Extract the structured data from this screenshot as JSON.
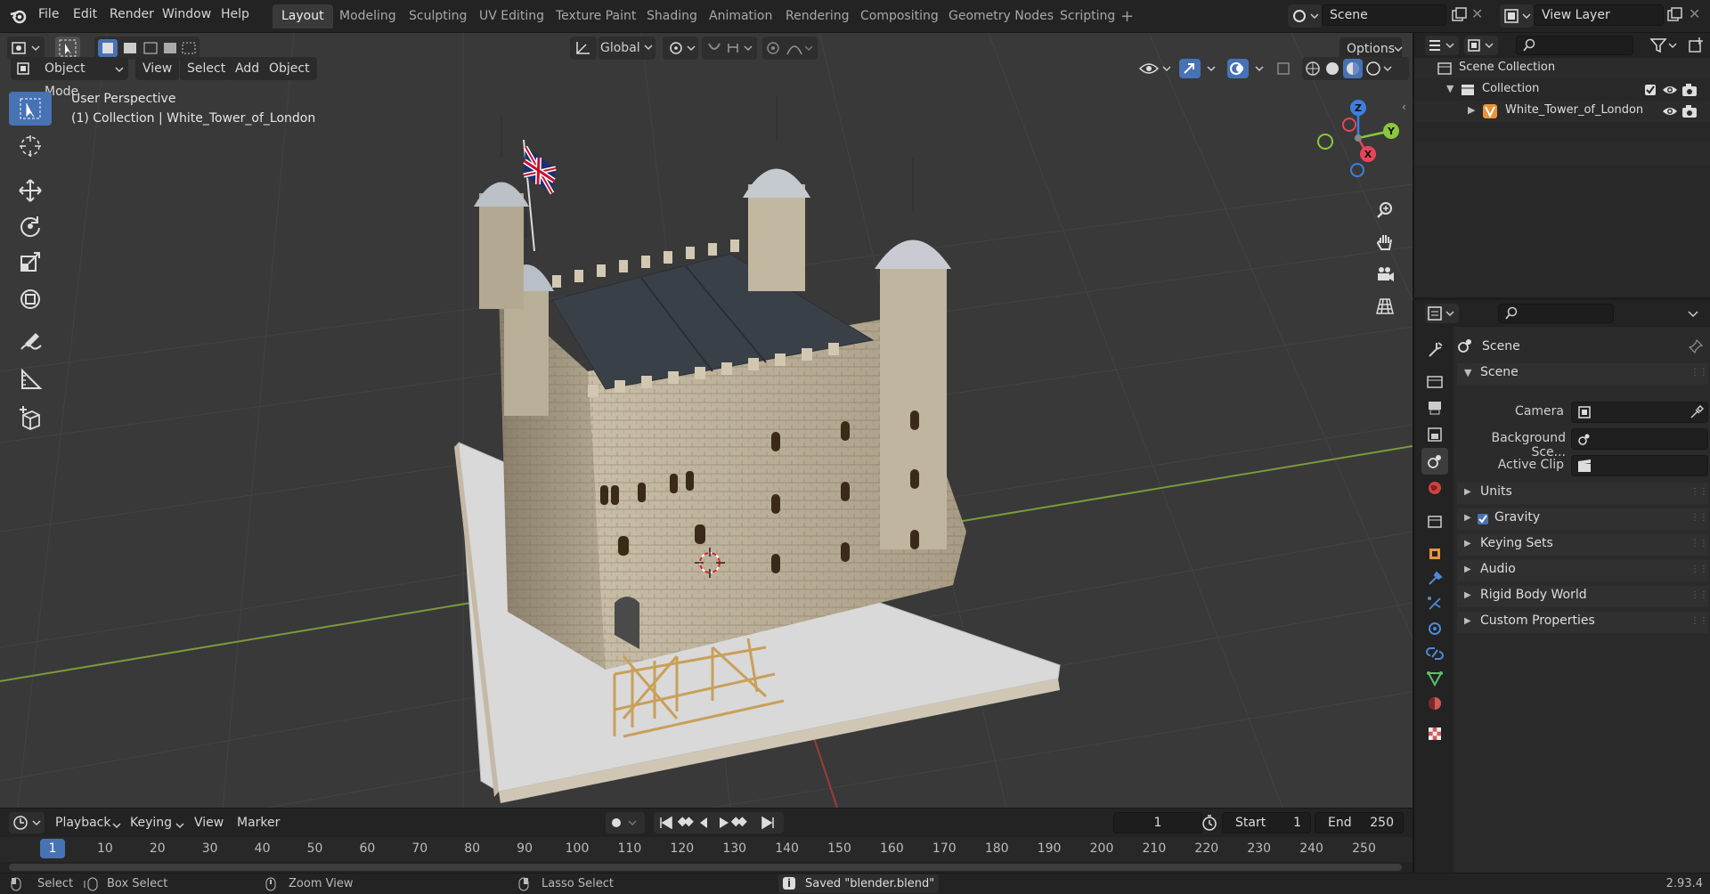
{
  "topbar": {
    "menus": [
      "File",
      "Edit",
      "Render",
      "Window",
      "Help"
    ],
    "workspaces": [
      "Layout",
      "Modeling",
      "Sculpting",
      "UV Editing",
      "Texture Paint",
      "Shading",
      "Animation",
      "Rendering",
      "Compositing",
      "Geometry Nodes",
      "Scripting"
    ],
    "active_workspace": "Layout",
    "scene_name": "Scene",
    "view_layer_name": "View Layer"
  },
  "viewport": {
    "mode": "Object Mode",
    "menus": [
      "View",
      "Select",
      "Add",
      "Object"
    ],
    "orientation": "Global",
    "options_label": "Options",
    "overlay_title": "User Perspective",
    "overlay_subtitle": "(1) Collection | White_Tower_of_London",
    "gizmo_axes": {
      "x": "X",
      "y": "Y",
      "z": "Z"
    },
    "colors": {
      "x": "#e8445a",
      "y": "#8bc83e",
      "z": "#3c7fe0",
      "grid_x_line": "#7a9a3c",
      "grid_y_line": "#9b3c3c",
      "tool_active": "#4772b3"
    }
  },
  "outliner": {
    "root": "Scene Collection",
    "collection": "Collection",
    "object": "White_Tower_of_London"
  },
  "properties": {
    "context": "Scene",
    "panel_title": "Scene",
    "fields": [
      {
        "label": "Camera"
      },
      {
        "label": "Background Sce..."
      },
      {
        "label": "Active Clip"
      }
    ],
    "subpanels": [
      "Units",
      "Gravity",
      "Keying Sets",
      "Audio",
      "Rigid Body World",
      "Custom Properties"
    ],
    "gravity_checked": true
  },
  "timeline": {
    "menus": [
      "Playback",
      "Keying",
      "View",
      "Marker"
    ],
    "current_frame": "1",
    "start_label": "Start",
    "start_value": "1",
    "end_label": "End",
    "end_value": "250",
    "ticks": [
      "1",
      "10",
      "20",
      "30",
      "40",
      "50",
      "60",
      "70",
      "80",
      "90",
      "100",
      "110",
      "120",
      "130",
      "140",
      "150",
      "160",
      "170",
      "180",
      "190",
      "200",
      "210",
      "220",
      "230",
      "240",
      "250"
    ]
  },
  "status": {
    "select": "Select",
    "box_select": "Box Select",
    "zoom_view": "Zoom View",
    "lasso_select": "Lasso Select",
    "message": "Saved \"blender.blend\"",
    "version": "2.93.4"
  }
}
